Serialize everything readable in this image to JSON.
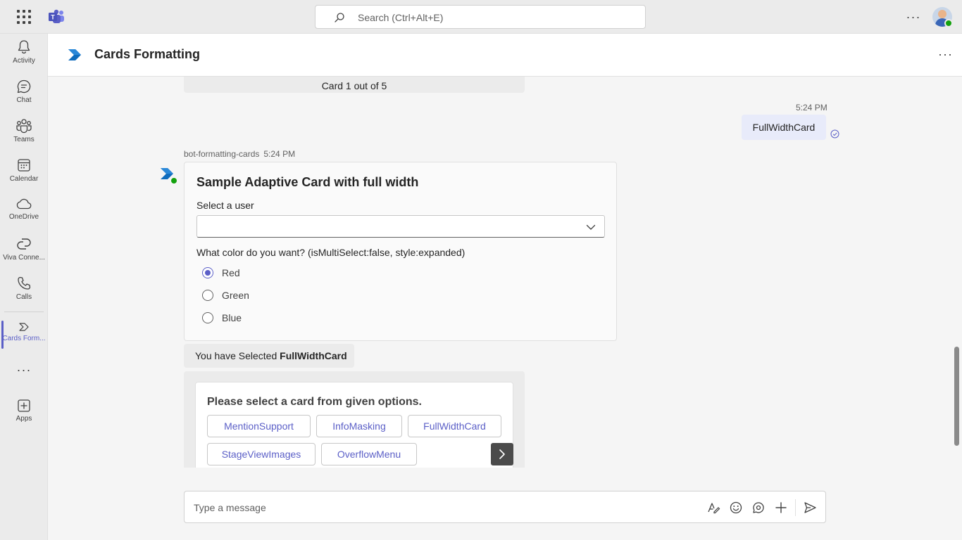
{
  "topbar": {
    "search_placeholder": "Search (Ctrl+Alt+E)",
    "more_label": "···"
  },
  "rail": {
    "items": [
      {
        "label": "Activity",
        "icon": "bell-icon"
      },
      {
        "label": "Chat",
        "icon": "chat-icon"
      },
      {
        "label": "Teams",
        "icon": "teams-icon"
      },
      {
        "label": "Calendar",
        "icon": "calendar-icon"
      },
      {
        "label": "OneDrive",
        "icon": "cloud-icon"
      },
      {
        "label": "Viva Conne...",
        "icon": "viva-icon"
      },
      {
        "label": "Calls",
        "icon": "phone-icon"
      },
      {
        "label": "Cards Form...",
        "icon": "cards-app-icon",
        "active": true
      }
    ],
    "more_label": "···",
    "apps_label": "Apps"
  },
  "header": {
    "title": "Cards Formatting",
    "more_label": "···"
  },
  "conversation": {
    "prev_card_text": "Card 1 out of 5",
    "my_message": {
      "time": "5:24 PM",
      "text": "FullWidthCard"
    },
    "bot_meta": {
      "name": "bot-formatting-cards",
      "time": "5:24 PM"
    },
    "adaptive_card": {
      "title": "Sample Adaptive Card with full width",
      "select_label": "Select a user",
      "select_value": "",
      "question": "What color do you want? (isMultiSelect:false, style:expanded)",
      "options": [
        {
          "label": "Red",
          "checked": true
        },
        {
          "label": "Green",
          "checked": false
        },
        {
          "label": "Blue",
          "checked": false
        }
      ]
    },
    "selected_message": {
      "prefix": "You have Selected ",
      "value": "FullWidthCard"
    },
    "carousel": {
      "title": "Please select a card from given options.",
      "buttons": [
        "MentionSupport",
        "InfoMasking",
        "FullWidthCard",
        "StageViewImages",
        "OverflowMenu"
      ]
    }
  },
  "compose": {
    "placeholder": "Type a message"
  },
  "colors": {
    "accent": "#5b5fc7",
    "my_bubble": "#e8ebfa",
    "presence": "#13a10e"
  }
}
